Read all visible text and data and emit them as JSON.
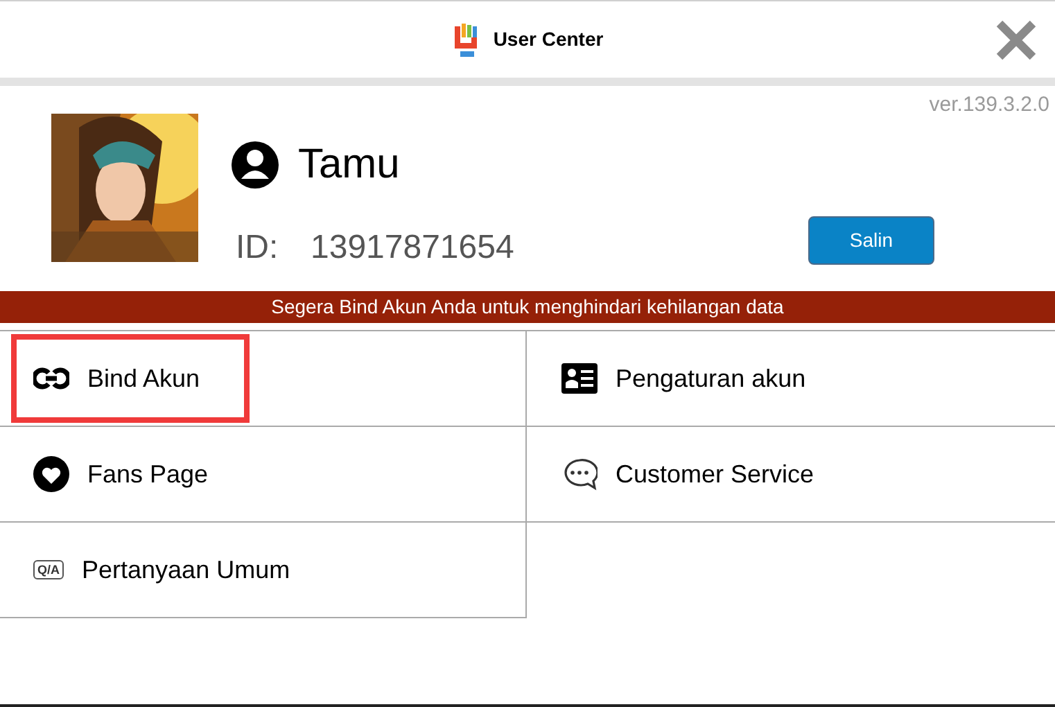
{
  "header": {
    "title": "User Center"
  },
  "version": "ver.139.3.2.0",
  "profile": {
    "name": "Tamu",
    "id_label": "ID:",
    "id_value": "13917871654",
    "copy_button": "Salin"
  },
  "banner": "Segera Bind Akun Anda untuk menghindari kehilangan data",
  "menu": [
    {
      "kind": "link",
      "label": "Bind Akun",
      "highlighted": true
    },
    {
      "kind": "card",
      "label": "Pengaturan akun",
      "highlighted": false
    },
    {
      "kind": "heart",
      "label": "Fans Page",
      "highlighted": false
    },
    {
      "kind": "chat",
      "label": "Customer Service",
      "highlighted": false
    },
    {
      "kind": "qa",
      "label": "Pertanyaan Umum",
      "icon_label": "Q/A",
      "highlighted": false
    }
  ]
}
